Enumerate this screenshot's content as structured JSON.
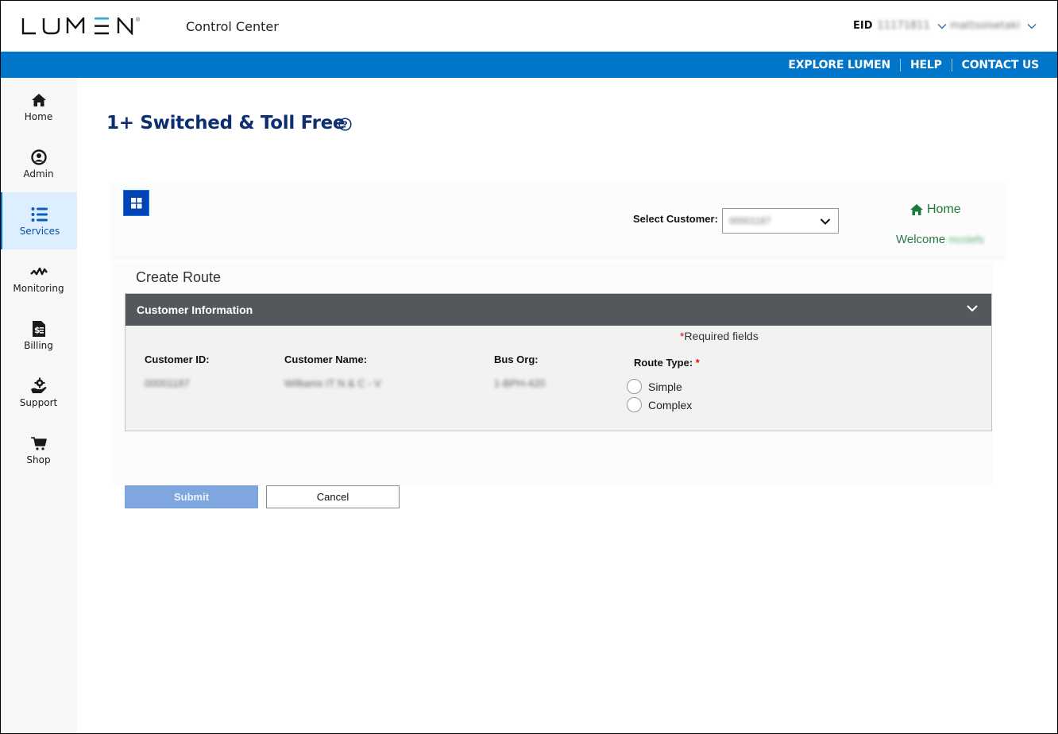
{
  "header": {
    "brand": "LUMEN",
    "app_title": "Control Center",
    "eid_label": "EID",
    "eid_value": "11171811",
    "username": "mattsoisetaki"
  },
  "utility_nav": [
    {
      "label": "EXPLORE LUMEN"
    },
    {
      "label": "HELP"
    },
    {
      "label": "CONTACT US"
    }
  ],
  "sidebar": {
    "items": [
      {
        "label": "Home",
        "icon": "home-icon",
        "active": false
      },
      {
        "label": "Admin",
        "icon": "user-circle-icon",
        "active": false
      },
      {
        "label": "Services",
        "icon": "list-icon",
        "active": true
      },
      {
        "label": "Monitoring",
        "icon": "pulse-icon",
        "active": false
      },
      {
        "label": "Billing",
        "icon": "invoice-icon",
        "active": false
      },
      {
        "label": "Support",
        "icon": "support-gear-hand-icon",
        "active": false
      },
      {
        "label": "Shop",
        "icon": "cart-icon",
        "active": false
      }
    ]
  },
  "page": {
    "title": "1+ Switched & Toll Free"
  },
  "toolbar": {
    "select_customer_label": "Select Customer:",
    "select_customer_value": "00001187",
    "home_link": "Home",
    "welcome_label": "Welcome",
    "welcome_user": "mcolefs"
  },
  "form": {
    "section_title": "Create Route",
    "accordion_title": "Customer Information",
    "required_note": "Required fields",
    "fields": [
      {
        "label": "Customer ID:",
        "value": "00001187"
      },
      {
        "label": "Customer Name:",
        "value": "Williams IT N & C - V"
      },
      {
        "label": "Bus Org:",
        "value": "1-BPH-420"
      }
    ],
    "route_type_label": "Route Type:",
    "route_type_options": [
      {
        "label": "Simple",
        "checked": false
      },
      {
        "label": "Complex",
        "checked": false
      }
    ]
  },
  "actions": {
    "submit_label": "Submit",
    "cancel_label": "Cancel"
  },
  "colors": {
    "brand_blue": "#0075c9",
    "title_navy": "#0d2f72",
    "accordion_header": "#54575c",
    "home_green": "#1c7a3c",
    "submit_disabled": "#7fa6de"
  }
}
